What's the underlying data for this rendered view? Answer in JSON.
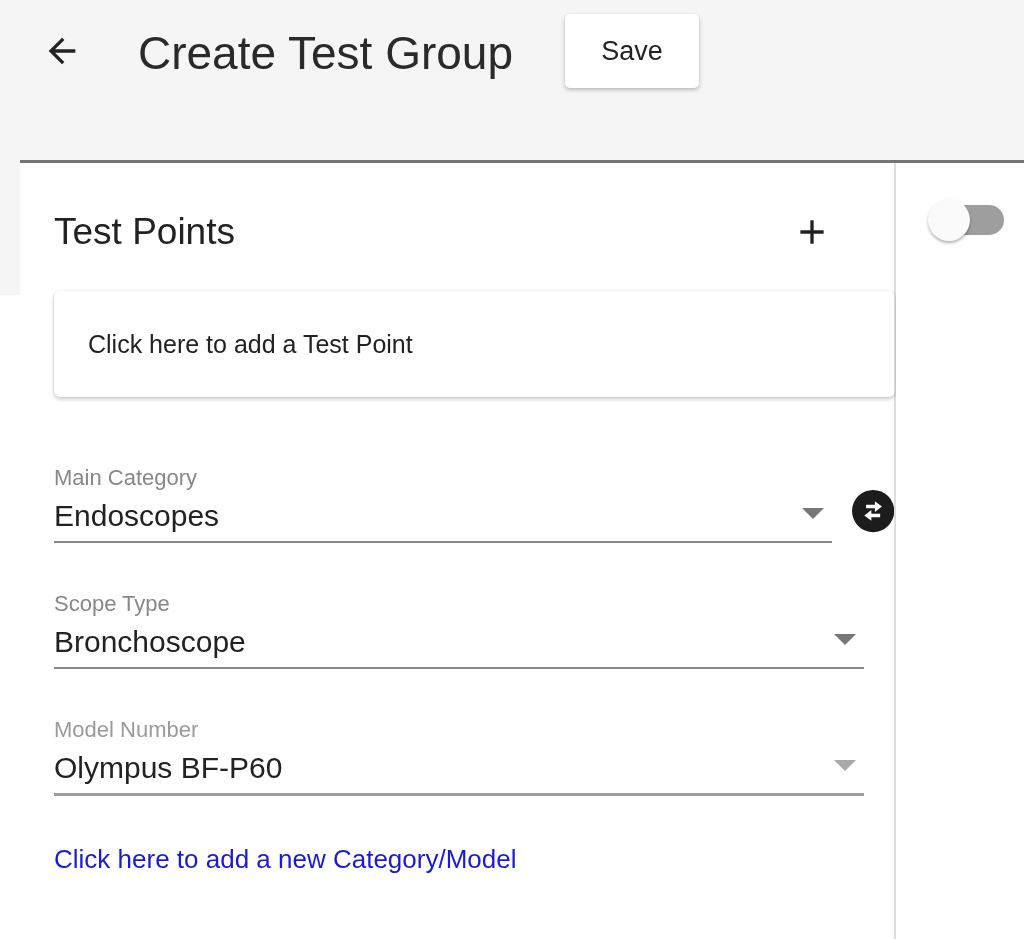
{
  "header": {
    "title": "Create Test Group",
    "save_button": "Save"
  },
  "panel": {
    "title": "Test Points",
    "add_card": "Click here to add a Test Point",
    "fields": [
      {
        "label": "Main Category",
        "value": "Endoscopes",
        "highlighted": false,
        "swap": true
      },
      {
        "label": "Scope Type",
        "value": "Bronchoscope",
        "highlighted": false,
        "swap": false
      },
      {
        "label": "Model Number",
        "value": "Olympus BF-P60",
        "highlighted": true,
        "swap": false
      }
    ],
    "link": "Click here to add a new Category/Model"
  },
  "toggle": {
    "on": false
  }
}
